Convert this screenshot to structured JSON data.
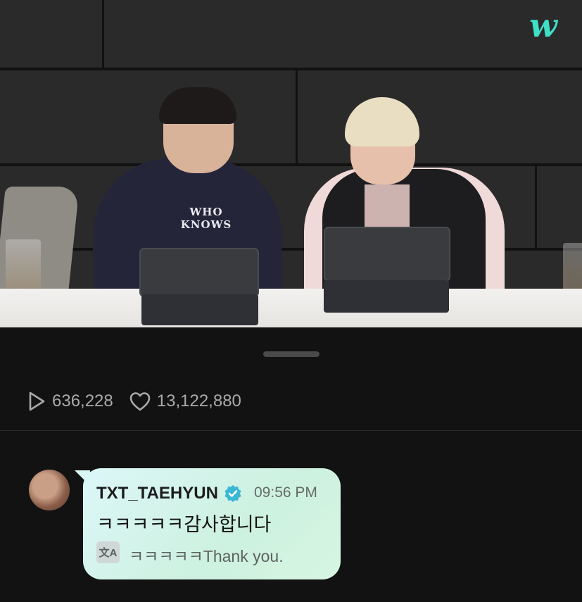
{
  "video": {
    "logo_icon": "weverse-logo-icon",
    "hoodie_text": "WHO KNOWS"
  },
  "stats": {
    "plays": "636,228",
    "likes": "13,122,880",
    "play_icon": "play-icon",
    "like_icon": "heart-icon"
  },
  "comment": {
    "author": "TXT_TAEHYUN",
    "verified_icon": "verified-badge-icon",
    "time": "09:56 PM",
    "message": "ㅋㅋㅋㅋㅋ감사합니다",
    "translate_icon": "translate-icon",
    "translation": "ㅋㅋㅋㅋㅋThank you."
  },
  "colors": {
    "background": "#121212",
    "accent": "#3ee0c8",
    "verified": "#3ab7d4"
  }
}
